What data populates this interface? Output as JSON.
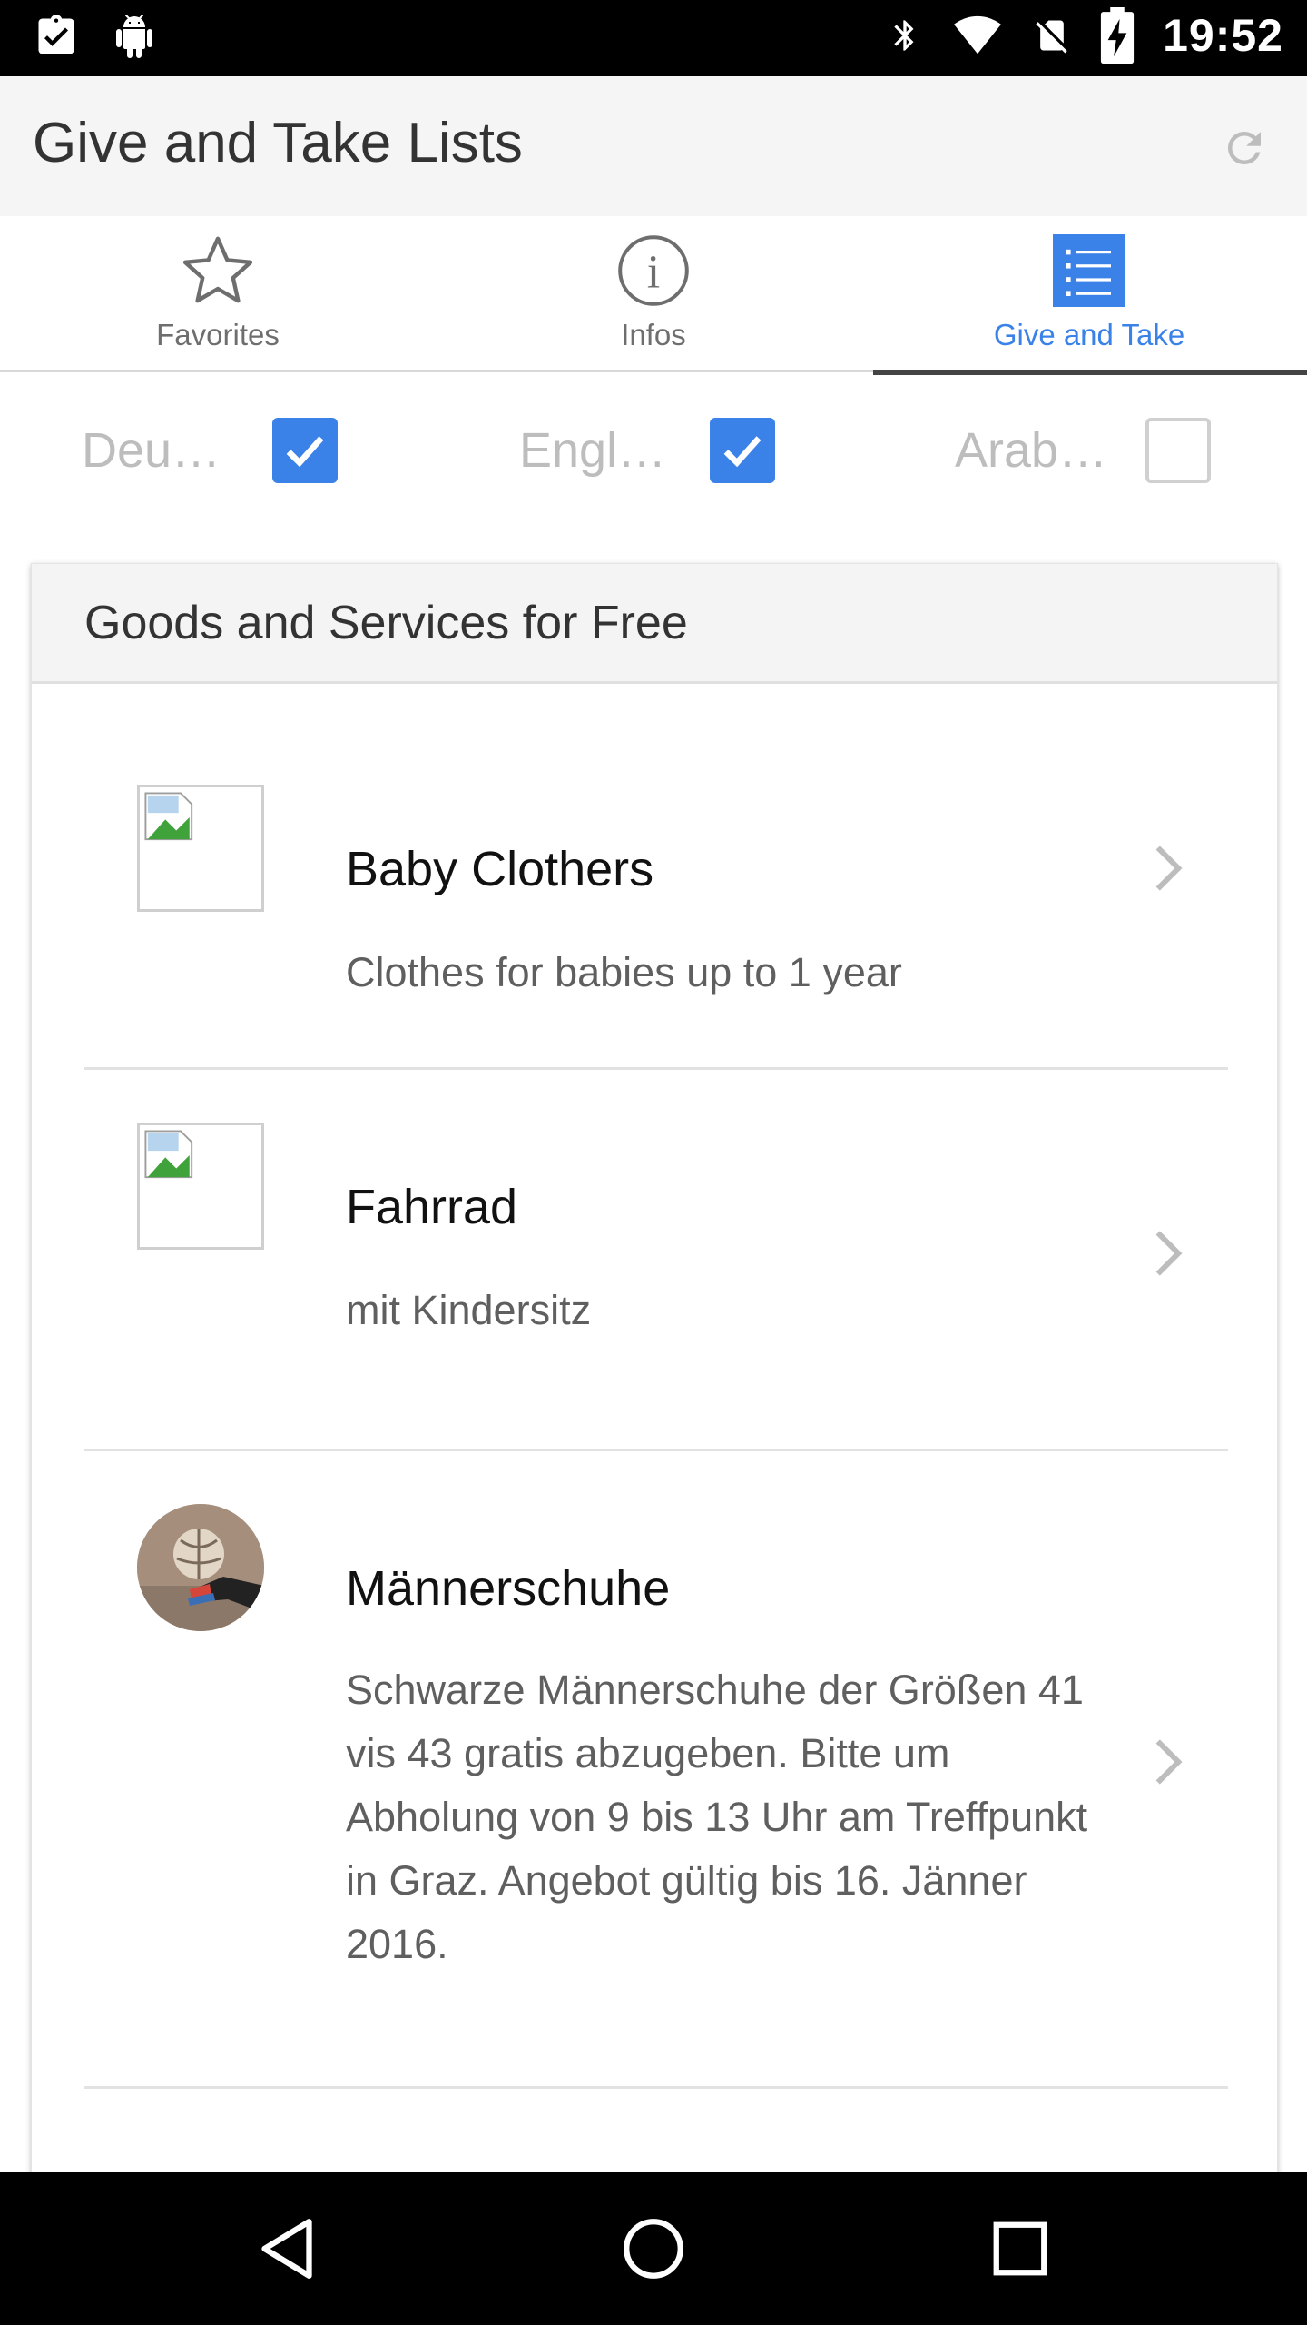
{
  "status_bar": {
    "time": "19:52",
    "left_icons": [
      "clipboard-check-icon",
      "android-icon"
    ],
    "right_icons": [
      "bluetooth-icon",
      "wifi-icon",
      "no-sim-icon",
      "battery-charging-icon"
    ]
  },
  "app_bar": {
    "title": "Give and Take Lists",
    "action_icon": "refresh-icon"
  },
  "tabs": [
    {
      "label": "Favorites",
      "icon": "star-outline-icon",
      "active": false
    },
    {
      "label": "Infos",
      "icon": "info-circle-icon",
      "active": false
    },
    {
      "label": "Give and Take",
      "icon": "list-icon",
      "active": true
    }
  ],
  "languages": [
    {
      "label": "Deu…",
      "checked": true
    },
    {
      "label": "Engl…",
      "checked": true
    },
    {
      "label": "Arab…",
      "checked": false
    }
  ],
  "card": {
    "title": "Goods and Services for Free",
    "items": [
      {
        "title": "Baby Clothers",
        "description": "Clothes for babies up to 1 year",
        "image": "broken-image-icon"
      },
      {
        "title": "Fahrrad",
        "description": "mit Kindersitz",
        "image": "broken-image-icon"
      },
      {
        "title": "Männerschuhe",
        "description": "Schwarze Männerschuhe der Größen 41 vis 43 gratis abzugeben. Bitte um Abholung von 9 bis 13 Uhr am Treffpunkt in Graz. Angebot gültig bis 16. Jänner 2016.",
        "image": "photo-avatar"
      }
    ]
  },
  "colors": {
    "accent": "#3a82e8",
    "app_bar_bg": "#f5f5f5",
    "inactive_text": "#6e6e6e"
  },
  "nav_bar": {
    "buttons": [
      "back-icon",
      "home-icon",
      "recents-icon"
    ]
  }
}
